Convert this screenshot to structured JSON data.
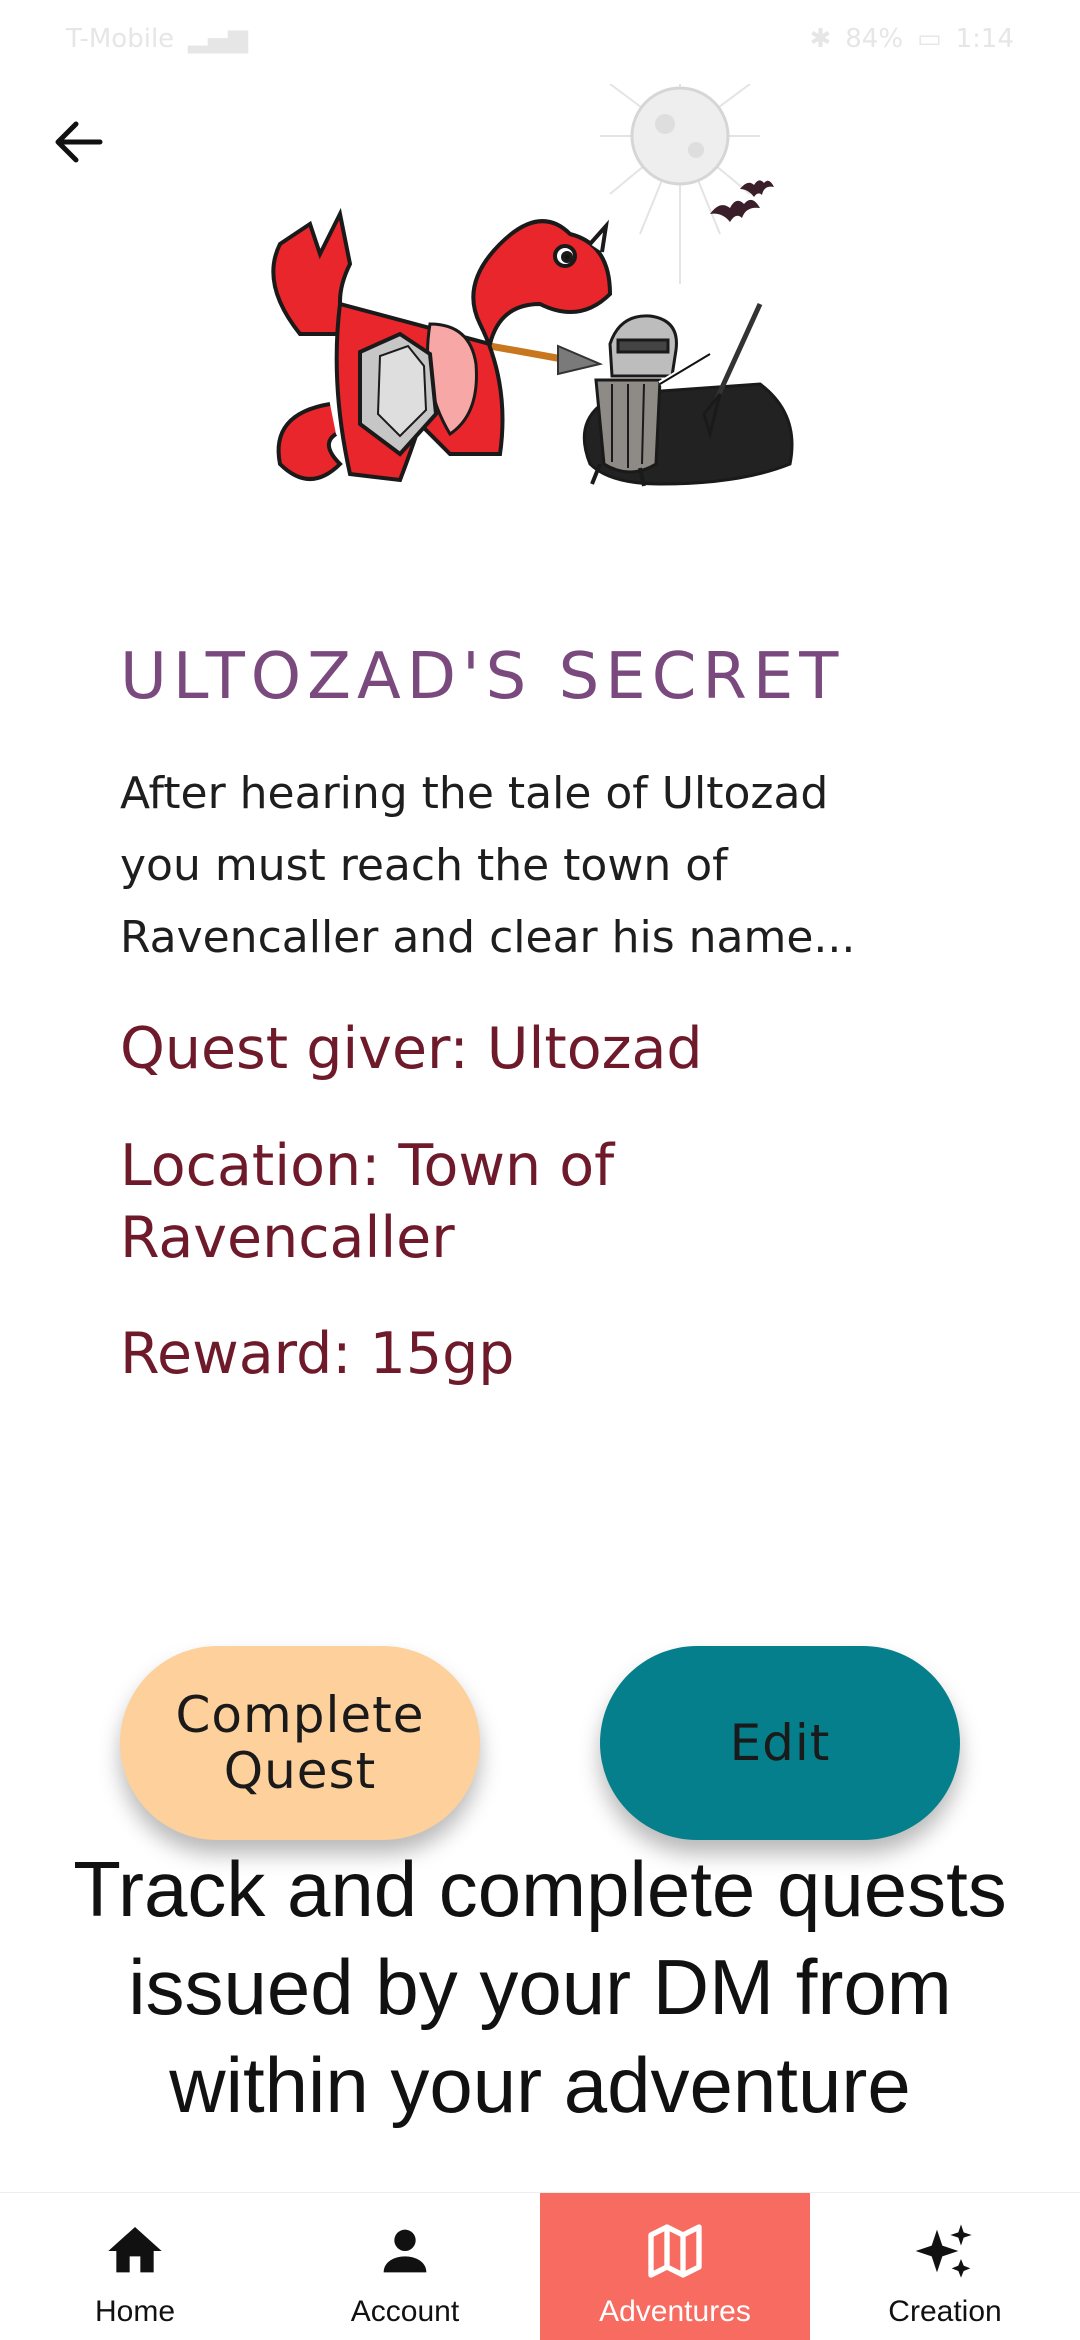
{
  "status_bar": {
    "carrier": "T-Mobile",
    "battery": "84%",
    "time": "1:14"
  },
  "quest": {
    "title": "ULTOZAD'S SECRET",
    "description": "After hearing the tale of Ultozad you must reach the town of Ravencaller and clear his name...",
    "giver": "Quest giver: Ultozad",
    "location": "Location: Town of Ravencaller",
    "reward": "Reward: 15gp"
  },
  "actions": {
    "complete_label": "Complete Quest",
    "edit_label": "Edit"
  },
  "tagline": "Track and complete quests issued by your DM from within your adventure",
  "nav": {
    "items": [
      {
        "label": "Home",
        "icon": "home-icon",
        "active": false
      },
      {
        "label": "Account",
        "icon": "account-icon",
        "active": false
      },
      {
        "label": "Adventures",
        "icon": "map-icon",
        "active": true
      },
      {
        "label": "Creation",
        "icon": "sparkle-icon",
        "active": false
      }
    ]
  },
  "colors": {
    "title": "#7a4a7e",
    "meta": "#6e1a2a",
    "complete_button": "#fdd09c",
    "edit_button": "#057f8c",
    "nav_active": "#f76b60"
  }
}
